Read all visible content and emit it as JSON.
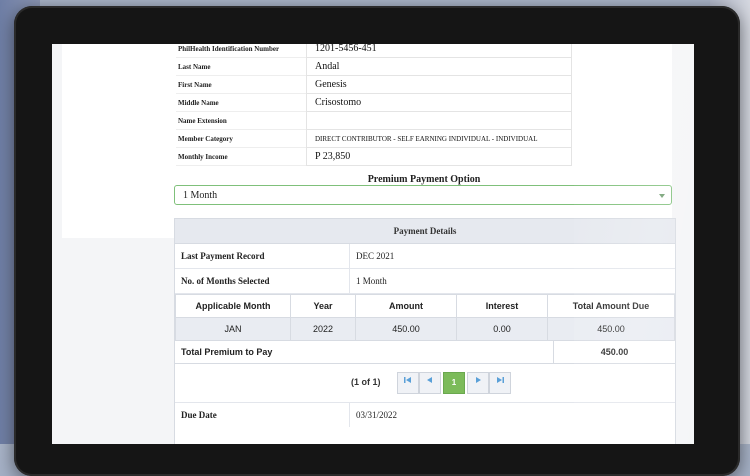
{
  "member_info": [
    {
      "label": "PhilHealth Identification Number",
      "value": "1201-5456-451"
    },
    {
      "label": "Last Name",
      "value": "Andal"
    },
    {
      "label": "First Name",
      "value": "Genesis"
    },
    {
      "label": "Middle Name",
      "value": "Crisostomo"
    },
    {
      "label": "Name Extension",
      "value": ""
    },
    {
      "label": "Member Category",
      "value": "DIRECT CONTRIBUTOR - SELF EARNING INDIVIDUAL - INDIVIDUAL"
    },
    {
      "label": "Monthly Income",
      "value": "P 23,850"
    }
  ],
  "premium_option": {
    "title": "Premium Payment Option",
    "selected": "1 Month"
  },
  "payment_details": {
    "header": "Payment Details",
    "last_payment_label": "Last Payment Record",
    "last_payment_value": "DEC 2021",
    "months_selected_label": "No. of Months Selected",
    "months_selected_value": "1 Month",
    "columns": [
      "Applicable Month",
      "Year",
      "Amount",
      "Interest",
      "Total Amount Due"
    ],
    "rows": [
      {
        "month": "JAN",
        "year": "2022",
        "amount": "450.00",
        "interest": "0.00",
        "total": "450.00"
      }
    ],
    "total_label": "Total Premium to Pay",
    "total_value": "450.00",
    "pager": {
      "count": "(1 of 1)",
      "current": "1"
    },
    "due_date_label": "Due Date",
    "due_date_value": "03/31/2022"
  }
}
